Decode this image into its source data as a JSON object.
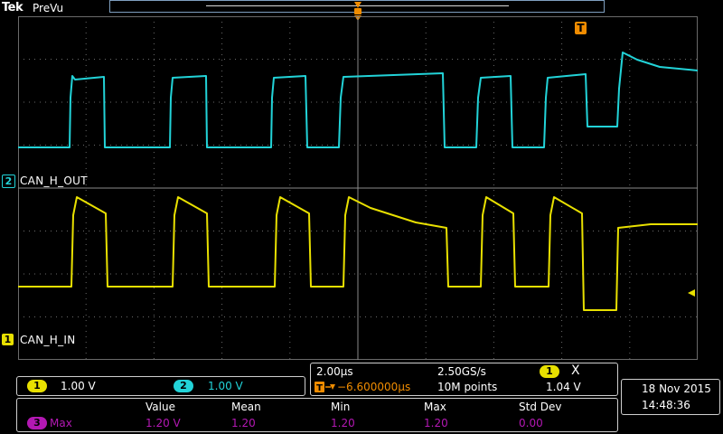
{
  "header": {
    "brand": "Tek",
    "mode": "PreVu"
  },
  "colors": {
    "ch1": "#e8e000",
    "ch2": "#22d3d8",
    "math": "#b318b3",
    "trigger": "#f08c00",
    "grid": "#6a6a6a"
  },
  "channels": [
    {
      "id": "2",
      "name": "CAN_H_OUT",
      "scale": "1.00 V"
    },
    {
      "id": "1",
      "name": "CAN_H_IN",
      "scale": "1.00 V"
    }
  ],
  "trigger": {
    "marker": "T"
  },
  "horizontal": {
    "timebase": "2.00µs",
    "position": "−6.600000µs",
    "sample_rate": "2.50GS/s",
    "record": "10M points"
  },
  "trigger_readout": {
    "channel": "1",
    "icon": "Χ",
    "level": "1.04 V"
  },
  "datetime": {
    "date": "18 Nov 2015",
    "time": "14:48:36"
  },
  "measurements": {
    "headers": [
      "Value",
      "Mean",
      "Min",
      "Max",
      "Std Dev"
    ],
    "row": {
      "source": "3",
      "name": "Max",
      "values": [
        "1.20 V",
        "1.20",
        "1.20",
        "1.20",
        "0.00"
      ]
    }
  }
}
